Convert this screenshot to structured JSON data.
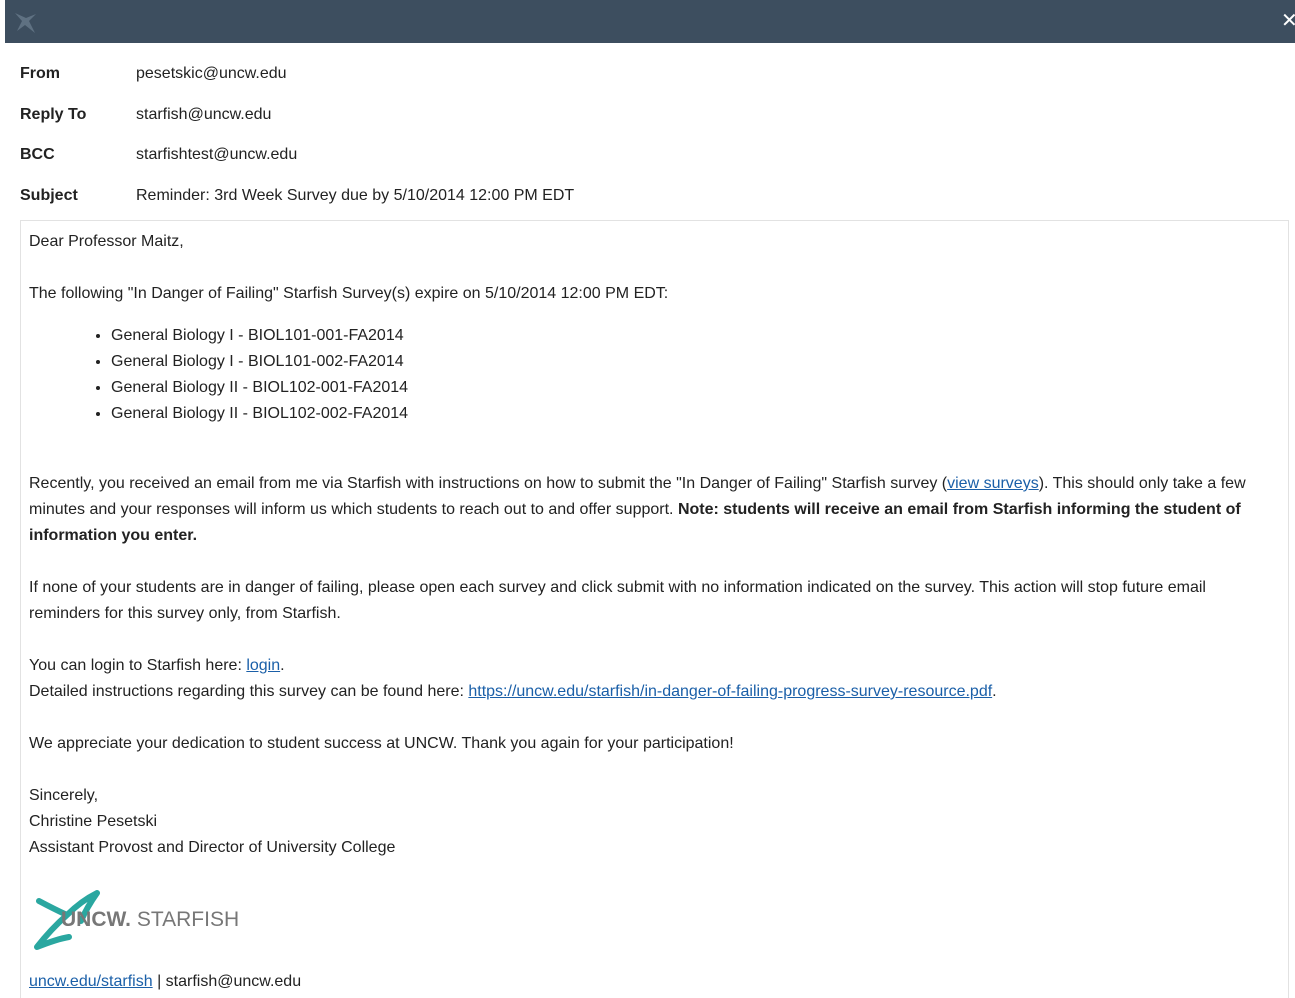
{
  "window": {
    "logo_icon": "starfish-icon",
    "close_icon": "close-icon",
    "close_glyph": "✕"
  },
  "headers": {
    "from_label": "From",
    "from_value": "pesetskic@uncw.edu",
    "reply_to_label": "Reply To",
    "reply_to_value": "starfish@uncw.edu",
    "bcc_label": "BCC",
    "bcc_value": "starfishtest@uncw.edu",
    "subject_label": "Subject",
    "subject_value": "Reminder: 3rd Week Survey due by 5/10/2014 12:00 PM EDT"
  },
  "body": {
    "greeting": "Dear Professor Maitz,",
    "intro": "The following \"In Danger of Failing\" Starfish Survey(s) expire on 5/10/2014 12:00 PM EDT:",
    "courses": [
      "General Biology I - BIOL101-001-FA2014",
      "General Biology I - BIOL101-002-FA2014",
      "General Biology II - BIOL102-001-FA2014",
      "General Biology II - BIOL102-002-FA2014"
    ],
    "para1_start": "Recently, you received an email from me via Starfish with instructions on how to submit the \"In Danger of Failing\" Starfish survey (",
    "view_surveys_link": "view surveys",
    "para1_mid": ").  This should only take a few minutes and your responses will inform us which students to reach out to and offer support.  ",
    "para1_note": "Note: students will receive an email from Starfish informing the student of information you enter.",
    "para2": "If none of your students are in danger of failing, please open each survey and click submit with no information indicated on the survey.  This action will stop future email reminders for this survey only, from Starfish.",
    "login_prefix": "You can login to Starfish here: ",
    "login_link": "login",
    "login_suffix": ".",
    "instructions_prefix": "Detailed instructions regarding this survey can be found here: ",
    "instructions_link": " https://uncw.edu/starfish/in-danger-of-failing-progress-survey-resource.pdf",
    "instructions_suffix": ".",
    "appreciation": "We appreciate your dedication to student success at UNCW.  Thank you again for your participation!",
    "closing": "Sincerely,",
    "sender_name": "Christine Pesetski",
    "sender_title": "Assistant Provost and Director of University College",
    "logo_uncw": "UNCW.",
    "logo_starfish": " STARFISH",
    "footer_link": "uncw.edu/starfish",
    "footer_sep": " | ",
    "footer_email": "starfish@uncw.edu"
  },
  "colors": {
    "titlebar": "#3d4e5f",
    "link": "#1a5fa8",
    "logo_teal": "#2aa7a0"
  }
}
